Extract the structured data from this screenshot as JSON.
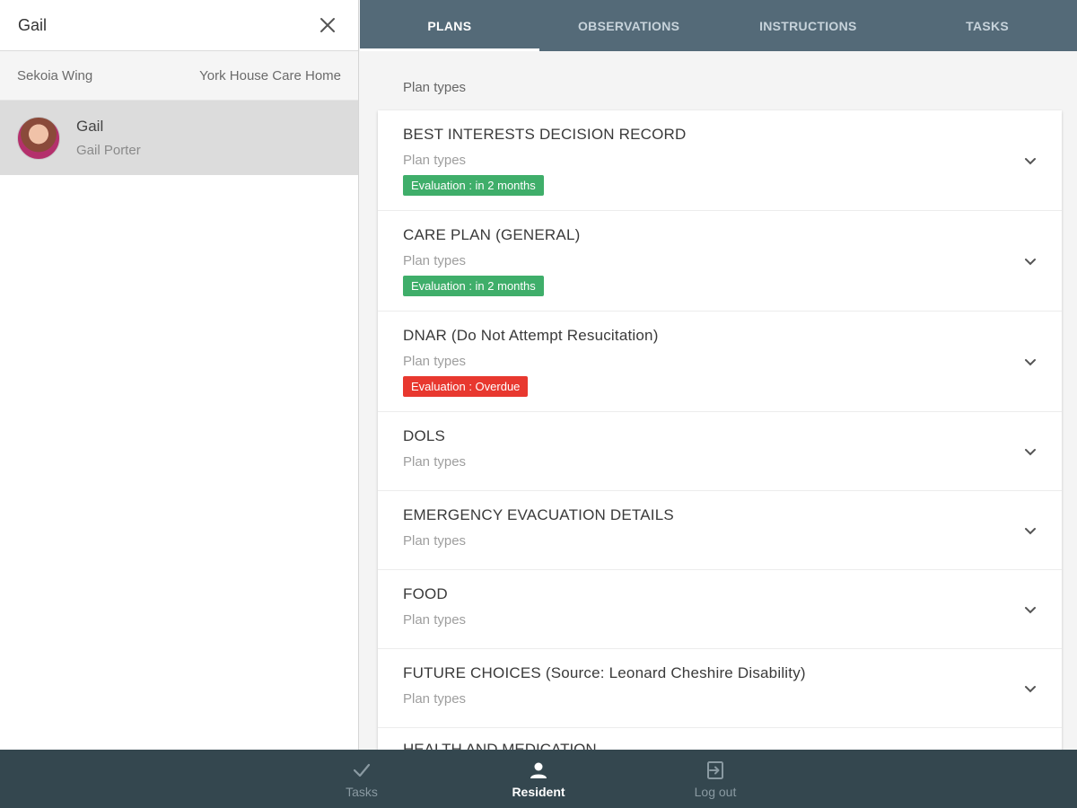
{
  "search": {
    "value": "Gail"
  },
  "location": {
    "wing": "Sekoia Wing",
    "home": "York House Care Home"
  },
  "resident": {
    "name": "Gail",
    "full_name": "Gail Porter"
  },
  "tabs": [
    {
      "label": "PLANS",
      "active": true
    },
    {
      "label": "OBSERVATIONS",
      "active": false
    },
    {
      "label": "INSTRUCTIONS",
      "active": false
    },
    {
      "label": "TASKS",
      "active": false
    }
  ],
  "plans": {
    "section_title": "Plan types",
    "items": [
      {
        "title": "BEST INTERESTS DECISION RECORD",
        "subtitle": "Plan types",
        "badge": "Evaluation : in 2 months",
        "badge_color": "#3fae6a"
      },
      {
        "title": "CARE PLAN (GENERAL)",
        "subtitle": "Plan types",
        "badge": "Evaluation : in 2 months",
        "badge_color": "#3fae6a"
      },
      {
        "title": "DNAR (Do Not Attempt Resucitation)",
        "subtitle": "Plan types",
        "badge": "Evaluation : Overdue",
        "badge_color": "#e8382f"
      },
      {
        "title": "DOLS",
        "subtitle": "Plan types"
      },
      {
        "title": "EMERGENCY EVACUATION DETAILS",
        "subtitle": "Plan types"
      },
      {
        "title": "FOOD",
        "subtitle": "Plan types"
      },
      {
        "title": "FUTURE CHOICES (Source: Leonard Cheshire Disability)",
        "subtitle": "Plan types"
      },
      {
        "title": "HEALTH AND MEDICATION"
      }
    ]
  },
  "bottom_nav": [
    {
      "label": "Tasks",
      "icon": "check-icon",
      "active": false
    },
    {
      "label": "Resident",
      "icon": "person-icon",
      "active": true
    },
    {
      "label": "Log out",
      "icon": "logout-icon",
      "active": false
    }
  ],
  "colors": {
    "header": "#546a78",
    "bottom_nav": "#34474f",
    "badge_green": "#3fae6a",
    "badge_red": "#e8382f"
  }
}
